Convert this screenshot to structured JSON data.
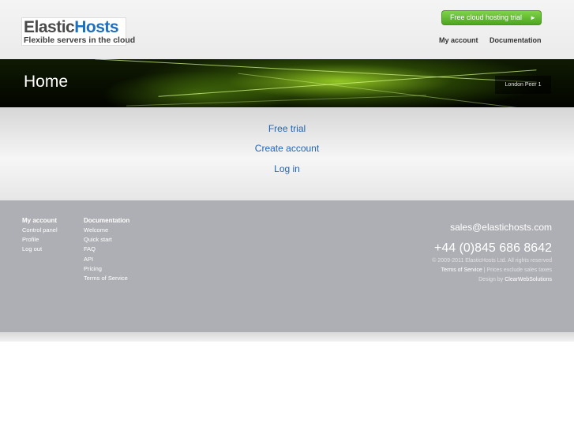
{
  "header": {
    "logo_part_a": "Elastic",
    "logo_part_b": "Hosts",
    "logo_tagline": "Flexible servers in the cloud",
    "trial_button": "Free cloud hosting trial",
    "trial_arrow": "►",
    "nav": [
      "My account",
      "Documentation"
    ]
  },
  "banner": {
    "title": "Home",
    "location": "London Peer 1"
  },
  "content": {
    "links": [
      "Free trial",
      "Create account",
      "Log in"
    ]
  },
  "footer": {
    "col_account": {
      "heading": "My account",
      "items": [
        "Control panel",
        "Profile",
        "Log out"
      ]
    },
    "col_docs": {
      "heading": "Documentation",
      "items": [
        "Welcome",
        "Quick start",
        "FAQ",
        "API",
        "Pricing",
        "Terms of Service"
      ]
    },
    "email": "sales@elastichosts.com",
    "phone": "+44 (0)845 686 8642",
    "copyright": "© 2009-2011 ElasticHosts Ltd. All rights reserved",
    "tos_link": "Terms of Service",
    "tos_suffix": " | Prices exclude sales taxes",
    "design_prefix": "Design by ",
    "designer": "ClearWebSolutions"
  },
  "colors": {
    "accent_link": "#1f64b9",
    "trial_green": "#5cb82a",
    "footer_gray": "#aeafb4"
  }
}
